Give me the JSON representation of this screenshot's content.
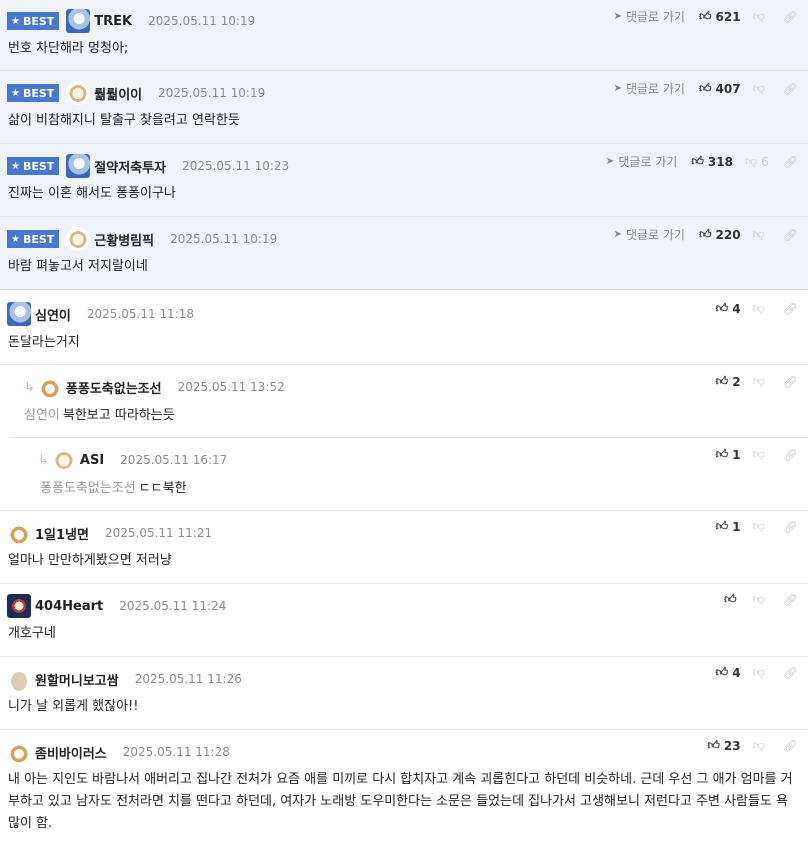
{
  "best_badge": "BEST",
  "goto_label": "댓글로 가기",
  "best": [
    {
      "nick": "TREK",
      "date": "2025.05.11 10:19",
      "text": "번호 차단해라 멍청아;",
      "up": "621",
      "down": ""
    },
    {
      "nick": "뤎뤎이이",
      "date": "2025.05.11 10:19",
      "text": "삶이 비참해지니 탈출구 찾을려고 연락한듯",
      "up": "407",
      "down": ""
    },
    {
      "nick": "절약저축투자",
      "date": "2025.05.11 10:23",
      "text": "진짜는 이혼 해서도 퐁퐁이구나",
      "up": "318",
      "down": "6"
    },
    {
      "nick": "근황병림픽",
      "date": "2025.05.11 10:19",
      "text": "바람 펴놓고서 저지랄이네",
      "up": "220",
      "down": ""
    }
  ],
  "comments": [
    {
      "nick": "심연이",
      "date": "2025.05.11 11:18",
      "text": "돈달라는거지",
      "mention": "",
      "up": "4"
    },
    {
      "nick": "퐁퐁도축없는조선",
      "date": "2025.05.11 13:52",
      "text": "북한보고 따라하는듯",
      "mention": "심연이",
      "up": "2"
    },
    {
      "nick": "ASI",
      "date": "2025.05.11 16:17",
      "text": "ㄷㄷ북한",
      "mention": "퐁퐁도축없는조선",
      "up": "1"
    },
    {
      "nick": "1일1냉면",
      "date": "2025.05.11 11:21",
      "text": "얼마나 만만하게봤으면 저러냥",
      "mention": "",
      "up": "1"
    },
    {
      "nick": "404Heart",
      "date": "2025.05.11 11:24",
      "text": "개호구네",
      "mention": "",
      "up": ""
    },
    {
      "nick": "원할머니보고쌈",
      "date": "2025.05.11 11:26",
      "text": "니가 날 외롭게 했잖아!!",
      "mention": "",
      "up": "4"
    },
    {
      "nick": "좀비바이러스",
      "date": "2025.05.11 11:28",
      "text": "내 아는 지인도 바람나서 애버리고 집나간 전처가 요즘 애를 미끼로 다시 합치자고 계속 괴롭힌다고 하던데 비슷하네. 근데 우선 그 애가 엄마를 거부하고 있고 남자도 전처라면 치를 떤다고 하던데, 여자가 노래방 도우미한다는 소문은 들었는데 집나가서 고생해보니 저런다고 주변 사람들도 욕 많이 함.",
      "mention": "",
      "up": "23"
    }
  ]
}
